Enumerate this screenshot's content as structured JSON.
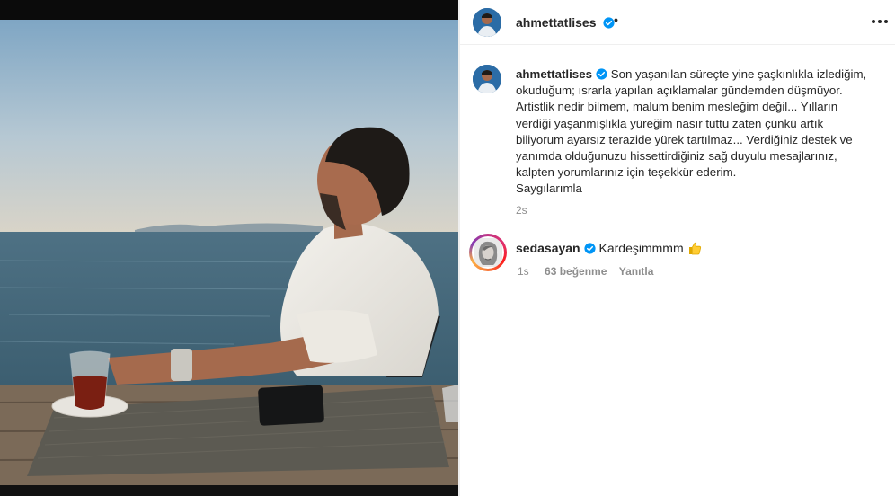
{
  "post": {
    "author": "ahmettatlises",
    "separator": "•",
    "more_icon": "more-horizontal-icon",
    "verified_icon": "verified-badge-icon"
  },
  "caption": {
    "username": "ahmettatlises",
    "lines": [
      "Son yaşanılan süreçte yine şaşkınlıkla izlediğim,",
      "okuduğum; ısrarla yapılan açıklamalar gündemden düşmüyor.",
      "Artistlik nedir bilmem, malum benim mesleğim değil... Yılların",
      "verdiği yaşanmışlıkla yüreğim nasır tuttu zaten çünkü artık",
      "biliyorum ayarsız terazide yürek tartılmaz... Verdiğiniz destek ve",
      "yanımda olduğunuzu hissettirdiğiniz sağ duyulu mesajlarınız,",
      "kalpten yorumlarınız için teşekkür ederim.",
      "Saygılarımla"
    ],
    "time": "2s"
  },
  "comment": {
    "username": "sedasayan",
    "text": "Kardeşimmmm",
    "emoji": "thumbs-up-emoji",
    "time": "1s",
    "likes": "63 beğenme",
    "reply": "Yanıtla"
  },
  "colors": {
    "verified": "#0095f6",
    "secondary_text": "#8e8e8e",
    "primary_text": "#262626"
  }
}
